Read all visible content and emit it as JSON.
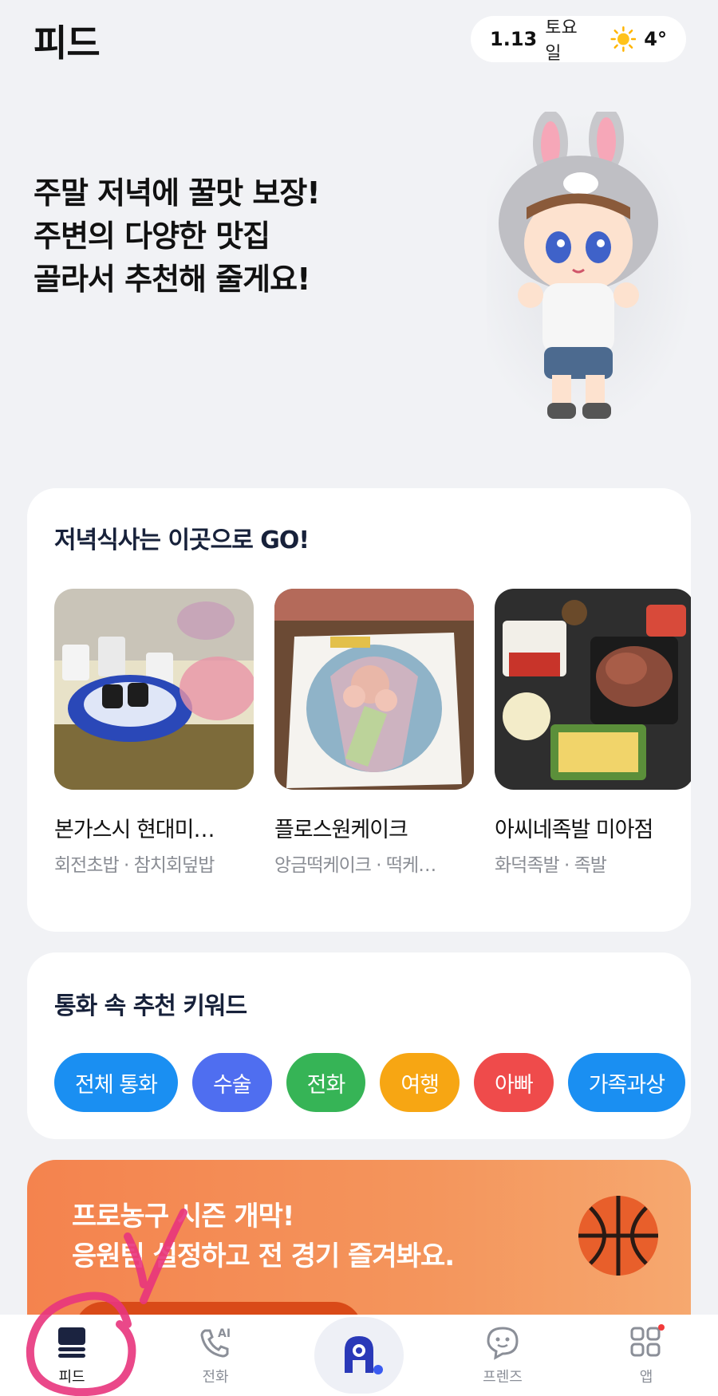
{
  "header": {
    "title": "피드",
    "date": "1.13",
    "weekday": "토요일",
    "weather_icon": "sun-icon",
    "temperature": "4°"
  },
  "hero": {
    "lines": [
      "주말 저녁에 꿀맛 보장!",
      "주변의 다양한 맛집",
      "골라서 추천해 줄게요!"
    ]
  },
  "restaurants": {
    "title": "저녁식사는 이곳으로 GO!",
    "items": [
      {
        "name": "본가스시 현대미…",
        "category": "회전초밥 · 참치회덮밥"
      },
      {
        "name": "플로스원케이크",
        "category": "앙금떡케이크 · 떡케…"
      },
      {
        "name": "아씨네족발 미아점",
        "category": "화덕족발 · 족발"
      }
    ]
  },
  "keywords": {
    "title": "통화 속 추천 키워드",
    "chips": [
      {
        "label": "전체 통화",
        "color": "#1a8ff2"
      },
      {
        "label": "수술",
        "color": "#4f6ef0"
      },
      {
        "label": "전화",
        "color": "#36b456"
      },
      {
        "label": "여행",
        "color": "#f7a613"
      },
      {
        "label": "아빠",
        "color": "#ef4b4b"
      },
      {
        "label": "가족과상",
        "color": "#1a8ff2"
      }
    ]
  },
  "banner": {
    "lines": [
      "프로농구 시즌 개막!",
      "응원팀 설정하고 전 경기 즐겨봐요."
    ],
    "icon": "basketball-icon"
  },
  "nav": {
    "items": [
      {
        "label": "피드",
        "icon": "feed-icon"
      },
      {
        "label": "전화",
        "icon": "ai-call-icon"
      },
      {
        "label": "",
        "icon": "assistant-icon"
      },
      {
        "label": "프렌즈",
        "icon": "friends-chat-icon"
      },
      {
        "label": "앱",
        "icon": "apps-grid-icon"
      }
    ]
  }
}
